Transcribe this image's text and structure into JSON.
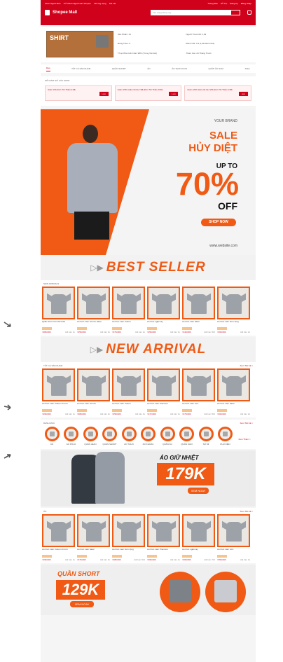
{
  "topbar": {
    "links_left": [
      "Kênh Người Bán",
      "Trở thành Người bán Shopee",
      "Tải ứng dụng",
      "Kết nối"
    ],
    "links_right": [
      "Thông Báo",
      "Hỗ Trợ",
      "Đăng Ký",
      "Đăng Nhập"
    ],
    "logo": "Shopee Mall",
    "search_placeholder": "Tìm trong Shop này"
  },
  "shop": {
    "card_word": "SHIRT",
    "stats": [
      "Sản Phẩm: 41",
      "Người Theo Dõi: 1,8k",
      "Đang Theo: 5",
      "Đánh Giá: 4.9 (1,6k Đánh Giá)",
      "Tỉ Lệ Phản Hồi Chat: 98% (Trong Vài Giờ)",
      "Tham Gia: 24 Tháng Trước"
    ]
  },
  "tabs": [
    "Dạo",
    "TẤT CẢ SẢN PHẨM",
    "QUẦN SHORT",
    "ÁO",
    "ÁO THUN ICON",
    "QUẦN ÂU NAM",
    "Thêm"
  ],
  "vouchers": {
    "title": "MÃ GIẢM GIÁ CỦA SHOP",
    "items": [
      {
        "text": "Giảm 15k Đơn Tối Thiểu 219k",
        "btn": "Lưu"
      },
      {
        "text": "Giảm 15% Giảm tối đa ₫30k Đơn Tối Thiểu 199k",
        "btn": "Lưu"
      },
      {
        "text": "Giảm 10% Giảm tối đa ₫20k Đơn Tối Thiểu 149k",
        "btn": "Lưu"
      }
    ]
  },
  "hero": {
    "brand": "YOUR BRAND",
    "sale": "SALE",
    "huy": "HỦY DIỆT",
    "upto": "UP TO",
    "pct": "70%",
    "off": "OFF",
    "shopnow": "SHOP NOW",
    "web": "www.website.com"
  },
  "bestseller": {
    "banner": "BEST SELLER",
    "head": "NEW ARRIVALS",
    "more": "",
    "products": [
      {
        "name": "Quần short nam thể thao",
        "price": "₫189.000",
        "sold": "Đã bán 1k"
      },
      {
        "name": "Áo thun nam cổ tròn basic",
        "price": "₫159.000",
        "sold": "Đã bán 3k"
      },
      {
        "name": "Áo thun nam Cotton",
        "price": "₫179.000",
        "sold": "Đã bán 2k"
      },
      {
        "name": "Áo thun ngắn tay",
        "price": "₫159.000",
        "sold": "Đã bán 1k"
      },
      {
        "name": "Áo thun nam basic",
        "price": "₫149.000",
        "sold": "Đã bán 900"
      },
      {
        "name": "Áo thun nam form rộng",
        "price": "₫169.000",
        "sold": "Đã bán 2k"
      }
    ]
  },
  "newarrival": {
    "banner": "NEW ARRIVAL",
    "head": "TẤT CẢ SẢN PHẨM",
    "more": "Xem Tất Cả >",
    "products": [
      {
        "name": "Áo thun nam Cotton cổ tròn",
        "price": "₫199.000",
        "sold": "Đã bán 1k"
      },
      {
        "name": "Áo thun nam cổ tròn",
        "price": "₫189.000",
        "sold": "Đã bán 2k"
      },
      {
        "name": "Áo thun nam Cotton",
        "price": "₫159.000",
        "sold": "Đã bán 3k"
      },
      {
        "name": "Áo thun nam Premium",
        "price": "₫172.000",
        "sold": "Đã bán 1k"
      },
      {
        "name": "Áo thun nam trơn",
        "price": "₫179.000",
        "sold": "Đã bán 800"
      },
      {
        "name": "Áo thun nam basic",
        "price": "₫169.000",
        "sold": "Đã bán 2k"
      }
    ]
  },
  "cats": {
    "head": "DANH MỤC",
    "more": "Xem Tất Cả >",
    "items": [
      "ÁO",
      "ÁO POLO",
      "QUẦN JEAN",
      "QUẦN SHORT",
      "ÁO THUN",
      "ÁO KHOÁC",
      "QUẦN ÂU",
      "QUẦN KAKI",
      "SƠ MI",
      "PHỤ KIỆN"
    ],
    "more_label": "Xem Thêm >"
  },
  "promo": {
    "title": "ÁO GIỮ NHIỆT",
    "price": "179K",
    "btn": "XEM NGAY"
  },
  "ao": {
    "head": "ÁO",
    "more": "Xem Tất Cả >",
    "products": [
      {
        "name": "Áo thun nam Cotton cổ tròn",
        "price": "₫199.000",
        "sold": "Đã bán 1k"
      },
      {
        "name": "Áo thun nam basic",
        "price": "₫179.000",
        "sold": "Đã bán 2k"
      },
      {
        "name": "Áo thun nam form rộng",
        "price": "₫189.000",
        "sold": "Đã bán 500"
      },
      {
        "name": "Áo thun nam Premium",
        "price": "₫199.000",
        "sold": "Đã bán 1k"
      },
      {
        "name": "Áo thun ngắn tay",
        "price": "₫169.000",
        "sold": "Đã bán 700"
      },
      {
        "name": "Áo thun nam trơn",
        "price": "₫159.000",
        "sold": "Đã bán 3k"
      }
    ]
  },
  "promo2": {
    "title": "QUẦN SHORT",
    "price": "129K",
    "btn": "XEM NGAY"
  }
}
